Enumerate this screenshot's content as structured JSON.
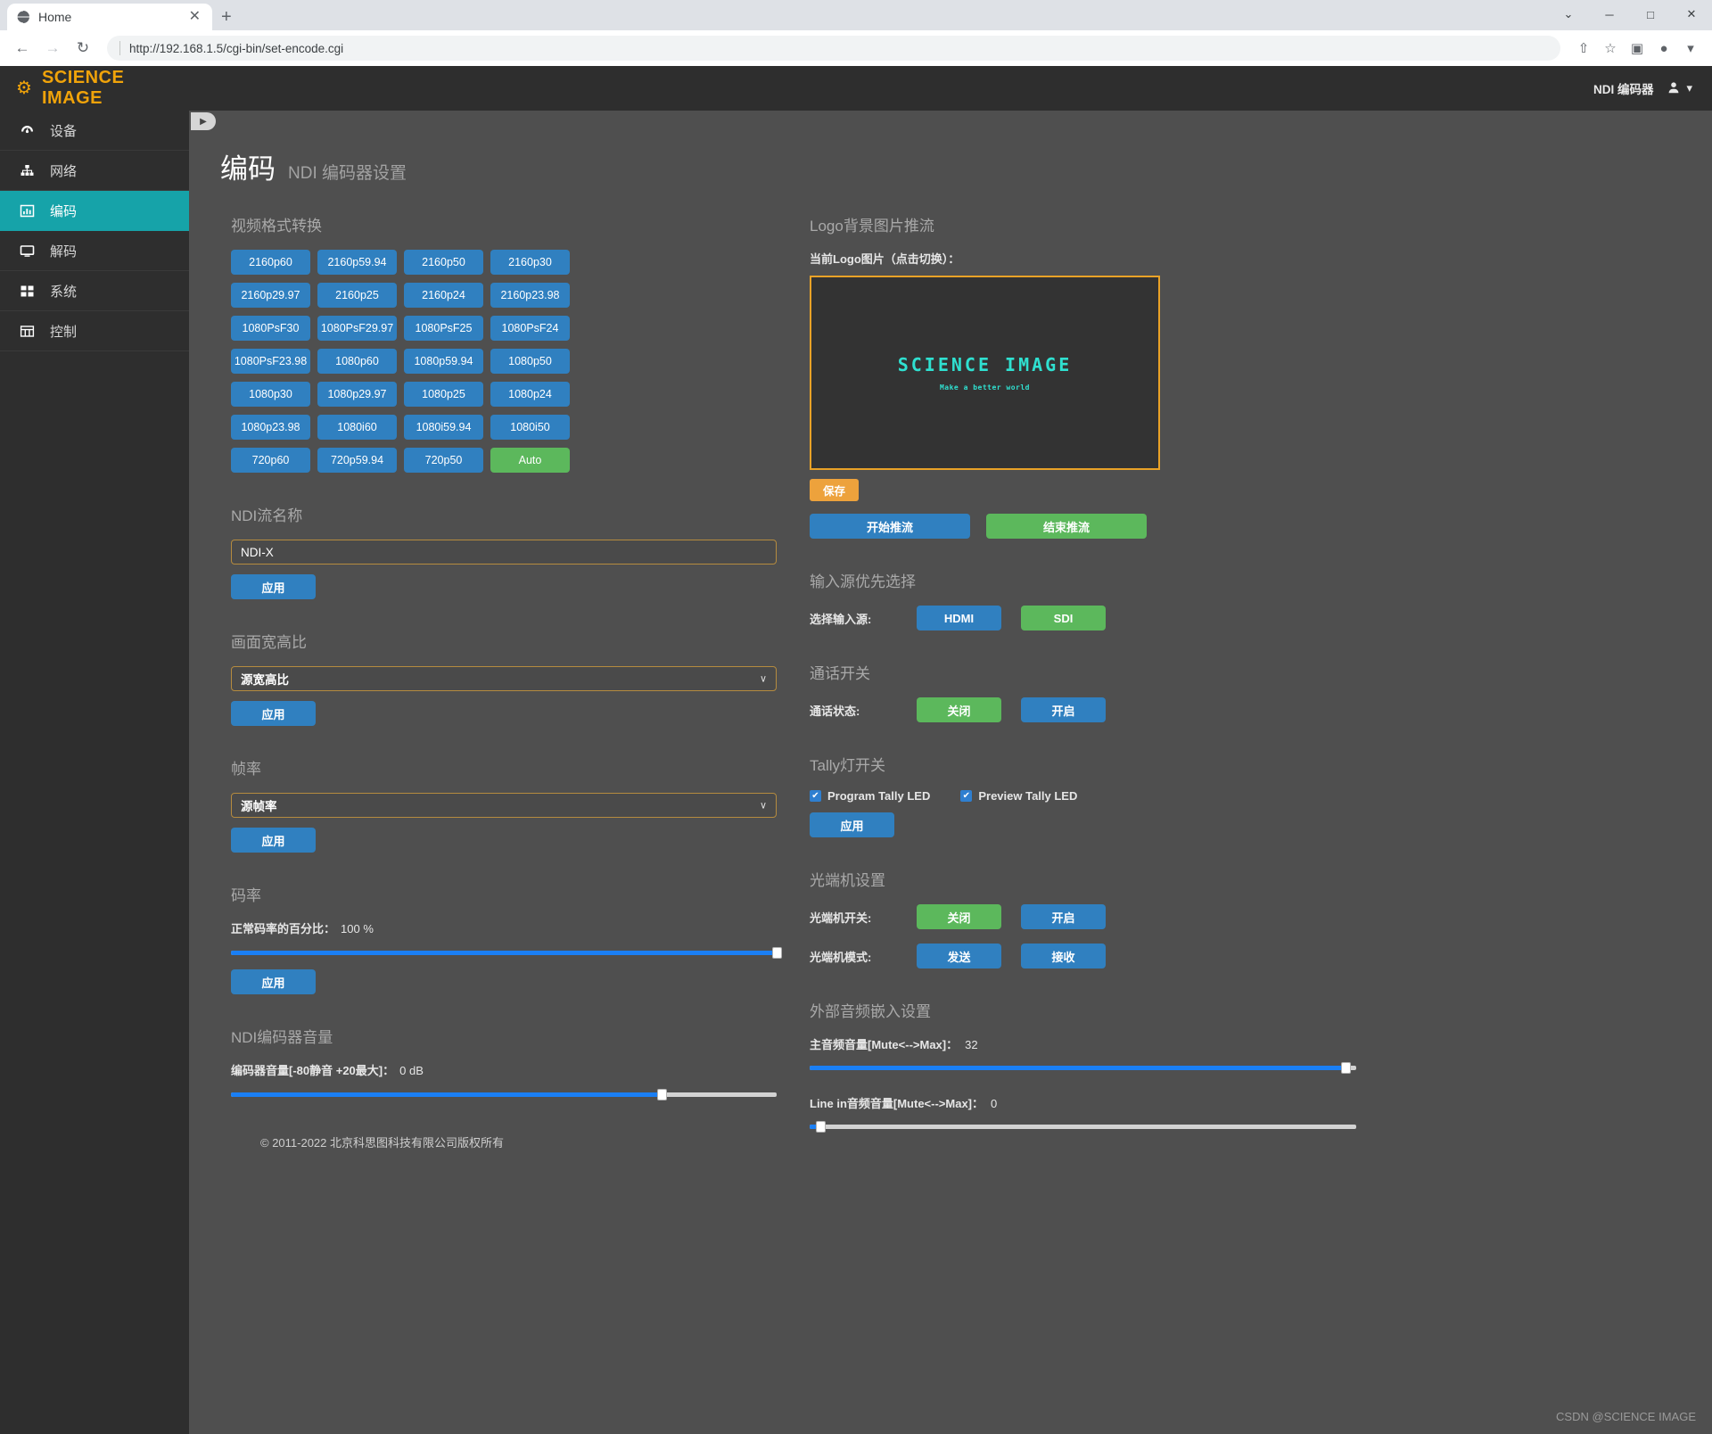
{
  "browser": {
    "tab_title": "Home",
    "tab_close": "✕",
    "new_tab": "+",
    "back": "←",
    "forward": "→",
    "reload": "↻",
    "url": "http://192.168.1.5/cgi-bin/set-encode.cgi",
    "minimize": "─",
    "maximize": "□",
    "close": "✕",
    "menu_caret": "⌄",
    "share_icon": "⇧",
    "star_icon": "☆",
    "panel_icon": "▣",
    "profile_icon": "●",
    "profile_caret": "▾"
  },
  "brand": {
    "icon": "⚙",
    "name": "SCIENCE IMAGE"
  },
  "topbar": {
    "device_label": "NDI 编码器",
    "user_caret": "▾"
  },
  "sidebar": {
    "items": [
      {
        "label": "设备",
        "icon": "dashboard-icon",
        "active": false
      },
      {
        "label": "网络",
        "icon": "sitemap-icon",
        "active": false
      },
      {
        "label": "编码",
        "icon": "chart-icon",
        "active": true
      },
      {
        "label": "解码",
        "icon": "monitor-icon",
        "active": false
      },
      {
        "label": "系统",
        "icon": "grid-icon",
        "active": false
      },
      {
        "label": "控制",
        "icon": "table-icon",
        "active": false
      }
    ]
  },
  "page": {
    "toggle_icon": "▶",
    "title": "编码",
    "subtitle": "NDI 编码器设置"
  },
  "video_format": {
    "title": "视频格式转换",
    "buttons": [
      {
        "label": "2160p60",
        "selected": false
      },
      {
        "label": "2160p59.94",
        "selected": false
      },
      {
        "label": "2160p50",
        "selected": false
      },
      {
        "label": "2160p30",
        "selected": false
      },
      {
        "label": "2160p29.97",
        "selected": false
      },
      {
        "label": "2160p25",
        "selected": false
      },
      {
        "label": "2160p24",
        "selected": false
      },
      {
        "label": "2160p23.98",
        "selected": false
      },
      {
        "label": "1080PsF30",
        "selected": false
      },
      {
        "label": "1080PsF29.97",
        "selected": false
      },
      {
        "label": "1080PsF25",
        "selected": false
      },
      {
        "label": "1080PsF24",
        "selected": false
      },
      {
        "label": "1080PsF23.98",
        "selected": false
      },
      {
        "label": "1080p60",
        "selected": false
      },
      {
        "label": "1080p59.94",
        "selected": false
      },
      {
        "label": "1080p50",
        "selected": false
      },
      {
        "label": "1080p30",
        "selected": false
      },
      {
        "label": "1080p29.97",
        "selected": false
      },
      {
        "label": "1080p25",
        "selected": false
      },
      {
        "label": "1080p24",
        "selected": false
      },
      {
        "label": "1080p23.98",
        "selected": false
      },
      {
        "label": "1080i60",
        "selected": false
      },
      {
        "label": "1080i59.94",
        "selected": false
      },
      {
        "label": "1080i50",
        "selected": false
      },
      {
        "label": "720p60",
        "selected": false
      },
      {
        "label": "720p59.94",
        "selected": false
      },
      {
        "label": "720p50",
        "selected": false
      },
      {
        "label": "Auto",
        "selected": true
      }
    ]
  },
  "ndi_name": {
    "title": "NDI流名称",
    "value": "NDI-X",
    "apply_label": "应用"
  },
  "aspect_ratio": {
    "title": "画面宽高比",
    "value": "源宽高比",
    "caret": "∨",
    "apply_label": "应用"
  },
  "frame_rate": {
    "title": "帧率",
    "value": "源帧率",
    "caret": "∨",
    "apply_label": "应用"
  },
  "bitrate": {
    "title": "码率",
    "meta_label": "正常码率的百分比：",
    "meta_value": "100 %",
    "percent": 100,
    "apply_label": "应用"
  },
  "encoder_volume": {
    "title": "NDI编码器音量",
    "meta_label": "编码器音量[-80静音 +20最大]：",
    "meta_value": "0 dB",
    "percent": 79
  },
  "logo_push": {
    "title": "Logo背景图片推流",
    "current_label": "当前Logo图片（点击切换）：",
    "preview_title": "SCIENCE IMAGE",
    "preview_tagline": "Make a better world",
    "save_label": "保存",
    "start_label": "开始推流",
    "stop_label": "结束推流"
  },
  "input_source": {
    "title": "输入源优先选择",
    "label": "选择输入源:",
    "option_a": {
      "label": "HDMI",
      "state": "blue"
    },
    "option_b": {
      "label": "SDI",
      "state": "green"
    }
  },
  "intercom": {
    "title": "通话开关",
    "label": "通话状态:",
    "option_a": {
      "label": "关闭",
      "state": "green"
    },
    "option_b": {
      "label": "开启",
      "state": "blue"
    }
  },
  "tally": {
    "title": "Tally灯开关",
    "program_label": "Program Tally LED",
    "program_checked": true,
    "preview_label": "Preview Tally LED",
    "preview_checked": true,
    "check_glyph": "✔",
    "apply_label": "应用"
  },
  "optical": {
    "title": "光端机设置",
    "switch_label": "光端机开关:",
    "switch_a": {
      "label": "关闭",
      "state": "green"
    },
    "switch_b": {
      "label": "开启",
      "state": "blue"
    },
    "mode_label": "光端机模式:",
    "mode_a": {
      "label": "发送",
      "state": "blue"
    },
    "mode_b": {
      "label": "接收",
      "state": "blue"
    }
  },
  "ext_audio": {
    "title": "外部音频嵌入设置",
    "main_label": "主音频音量[Mute<-->Max]：",
    "main_value": "32",
    "main_percent": 98,
    "line_label": "Line in音频音量[Mute<-->Max]：",
    "line_value": "0",
    "line_percent": 2
  },
  "footer": {
    "copyright": "© 2011-2022 北京科思图科技有限公司版权所有"
  },
  "watermark": {
    "text": "CSDN @SCIENCE IMAGE"
  }
}
